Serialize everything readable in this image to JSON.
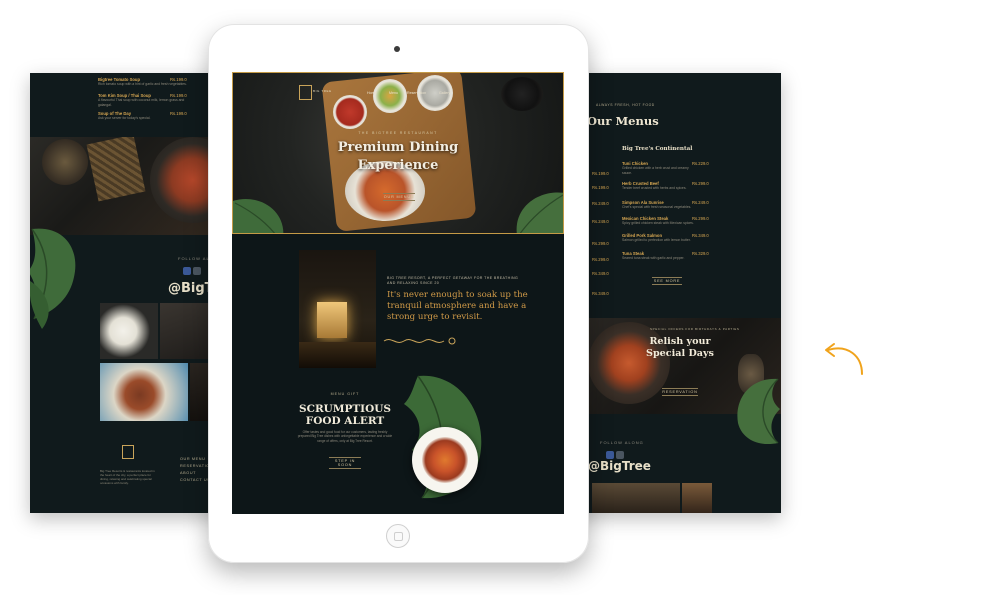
{
  "left_page": {
    "menu_items": [
      {
        "name": "Bigtree Tomato Soup",
        "price": "Rs.199.0",
        "desc": "Rich tomato soup with a hint of garlic and fresh vegetables."
      },
      {
        "name": "Tom Kim Soup / Thai Soup",
        "price": "Rs.199.0",
        "desc": "A flavourful Thai soup with coconut milk, lemon grass and galangal."
      },
      {
        "name": "Soup of The Day",
        "price": "Rs.199.0",
        "desc": "Ask your server for today's special."
      }
    ],
    "follow_label": "FOLLOW ALONG",
    "handle": "@BigTree",
    "footer_about": "Big Tree Resorts & restaurants located in the heart of the city, a perfect place for dining, relaxing and celebrating special occasions with family.",
    "footer_links": [
      "OUR MENU",
      "RESERVATION",
      "ABOUT",
      "CONTACT US"
    ]
  },
  "tablet": {
    "nav": [
      "Home",
      "Menu",
      "Reservation",
      "Gallery"
    ],
    "logo_text": "BIG TREE",
    "hero_kicker": "THE BIGTREE RESTAURANT",
    "hero_title_line1": "Premium Dining",
    "hero_title_line2": "Experience",
    "hero_button": "OUR MENUS",
    "intro_small": "BIG TREE RESORT, A PERFECT GETAWAY FOR THE BREATHING AND RELAXING SINCE 20",
    "intro_quote": "It's never enough to soak up the tranquil atmosphere and have a strong urge to revisit.",
    "food_pre": "MENU GIFT",
    "food_title_line1": "SCRUMPTIOUS",
    "food_title_line2": "FOOD ALERT",
    "food_desc": "Offer tastes and good food for our customers, tasting freshly prepared Big Tree dishes with unforgettable experience and a wide range of offers, only at Big Tree Resort.",
    "food_button": "STEP IN SOON"
  },
  "right_page": {
    "kicker": "ALWAYS FRESH, HOT FOOD",
    "title": "Our Menus",
    "menu_heading": "Big Tree's Continental",
    "items": [
      {
        "name": "Tuni Chicken",
        "price": "Rs.229.0",
        "desc": "Grilled chicken with a herb crust and creamy sauce."
      },
      {
        "name": "Herb Crusted Beef",
        "price": "Rs.299.0",
        "desc": "Tender beef crusted with herbs and spices."
      },
      {
        "name": "Simpson Ala Sunrise",
        "price": "Rs.249.0",
        "desc": "Chef's special with fresh seasonal vegetables."
      },
      {
        "name": "Mexican Chicken Steak",
        "price": "Rs.299.0",
        "desc": "Spicy grilled chicken steak with Mexican spices."
      },
      {
        "name": "Grilled Pork Salmon",
        "price": "Rs.349.0",
        "desc": "Salmon grilled to perfection with lemon butter."
      },
      {
        "name": "Tuna Steak",
        "price": "Rs.329.0",
        "desc": "Seared tuna steak with garlic and pepper."
      }
    ],
    "left_prices": [
      "Rs.199.0",
      "Rs.199.0",
      "Rs.249.0",
      "Rs.249.0",
      "Rs.299.0",
      "Rs.299.0",
      "Rs.349.0",
      "Rs.349.0"
    ],
    "menu_button": "SEE MORE",
    "relish_kicker": "SPECIAL OFFERS FOR BIRTHDAYS & PARTIES",
    "relish_line1": "Relish your",
    "relish_line2": "Special Days",
    "relish_button": "RESERVATION",
    "follow_label": "FOLLOW ALONG",
    "handle": "@BigTree"
  },
  "colors": {
    "page_bg": "#ffffff",
    "site_bg": "#101a1c",
    "gold": "#c9a45a",
    "accent_orange": "#f0a31c",
    "social_blue": "#3b5998"
  },
  "icons": [
    "facebook-icon",
    "instagram-icon",
    "camera-icon",
    "home-button-icon",
    "curved-arrow-icon",
    "monstera-leaf-icon"
  ]
}
